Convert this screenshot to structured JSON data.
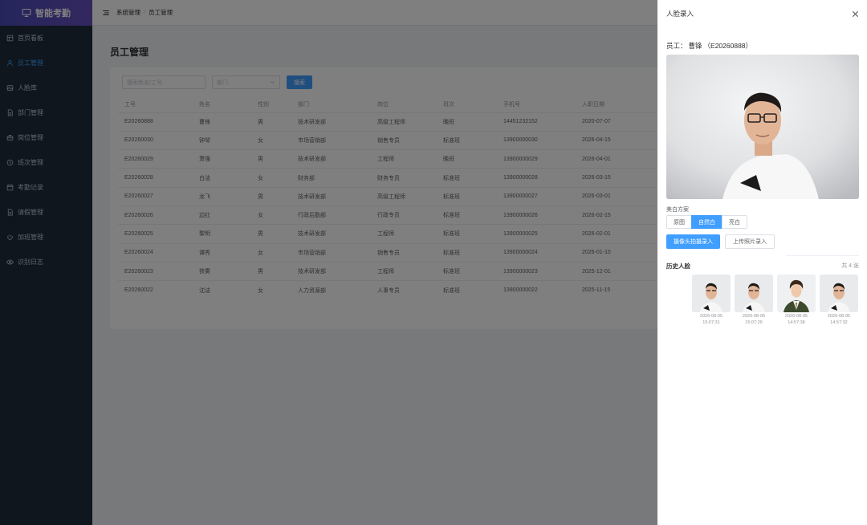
{
  "app": {
    "title": "智能考勤"
  },
  "sidebar": {
    "items": [
      {
        "label": "首页看板",
        "icon": "dashboard-icon",
        "active": false
      },
      {
        "label": "员工管理",
        "icon": "user-icon",
        "active": true
      },
      {
        "label": "人脸库",
        "icon": "image-icon",
        "active": false
      },
      {
        "label": "部门管理",
        "icon": "document-icon",
        "active": false
      },
      {
        "label": "岗位管理",
        "icon": "briefcase-icon",
        "active": false
      },
      {
        "label": "班次管理",
        "icon": "clock-icon",
        "active": false
      },
      {
        "label": "考勤记录",
        "icon": "calendar-icon",
        "active": false
      },
      {
        "label": "请假管理",
        "icon": "document-icon",
        "active": false
      },
      {
        "label": "加班管理",
        "icon": "power-icon",
        "active": false
      },
      {
        "label": "识别日志",
        "icon": "eye-icon",
        "active": false
      }
    ]
  },
  "header": {
    "breadcrumb": [
      "系统管理",
      "员工管理"
    ]
  },
  "page": {
    "title": "员工管理",
    "search_placeholder": "搜索姓名/工号",
    "dept_placeholder": "部门",
    "search_button": "搜索"
  },
  "table": {
    "columns": [
      "工号",
      "姓名",
      "性别",
      "部门",
      "岗位",
      "班次",
      "手机号",
      "入职日期"
    ],
    "rows": [
      [
        "E20260888",
        "曹锋",
        "男",
        "技术研发部",
        "高级工程师",
        "晚班",
        "14451232152",
        "2020-07-07"
      ],
      [
        "E20260030",
        "钟琴",
        "女",
        "市场营销部",
        "销售专员",
        "标准班",
        "13900000030",
        "2026-04-15"
      ],
      [
        "E20260029",
        "萧强",
        "男",
        "技术研发部",
        "工程师",
        "晚班",
        "13900000029",
        "2026-04-01"
      ],
      [
        "E20260028",
        "白洁",
        "女",
        "财务部",
        "财务专员",
        "标准班",
        "13900000028",
        "2026-03-15"
      ],
      [
        "E20260027",
        "龙飞",
        "男",
        "技术研发部",
        "高级工程师",
        "标准班",
        "13900000027",
        "2026-03-01"
      ],
      [
        "E20260026",
        "边红",
        "女",
        "行政后勤部",
        "行政专员",
        "标准班",
        "13900000026",
        "2026-02-15"
      ],
      [
        "E20260025",
        "黎明",
        "男",
        "技术研发部",
        "工程师",
        "标准班",
        "13900000025",
        "2026-02-01"
      ],
      [
        "E20260024",
        "谭秀",
        "女",
        "市场营销部",
        "销售专员",
        "标准班",
        "13900000024",
        "2026-01-10"
      ],
      [
        "E20260023",
        "铁雾",
        "男",
        "技术研发部",
        "工程师",
        "标准班",
        "13900000023",
        "2025-12-01"
      ],
      [
        "E20260022",
        "沈洁",
        "女",
        "人力资源部",
        "人事专员",
        "标准班",
        "13900000022",
        "2025-11-15"
      ]
    ]
  },
  "drawer": {
    "title": "人脸录入",
    "employee_label": "员工：",
    "employee_name": "曹锋",
    "employee_id": "（E20260888）",
    "beauty_label": "美白方案",
    "beauty_options": [
      {
        "label": "原图",
        "selected": false
      },
      {
        "label": "自然白",
        "selected": true
      },
      {
        "label": "亮白",
        "selected": false
      }
    ],
    "capture_button": "摄像头拍摄录入",
    "upload_button": "上传照片录入",
    "history_title": "历史人脸",
    "history_count": "共 4 张",
    "history": [
      {
        "time": "2026-08-05 15:07:31"
      },
      {
        "time": "2026-08-05 15:07:29"
      },
      {
        "time": "2026-08-05 14:57:38"
      },
      {
        "time": "2026-08-05 14:57:32"
      }
    ]
  },
  "colors": {
    "primary": "#409eff",
    "sidebar_bg": "#1f2d3d",
    "logo_gradient": "#5a4dbd"
  }
}
